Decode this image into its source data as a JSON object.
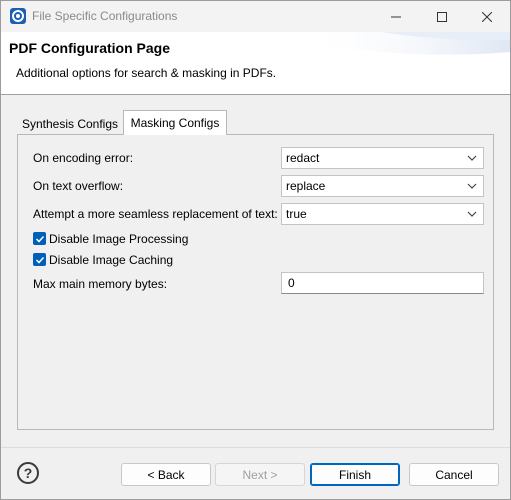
{
  "window": {
    "title": "File Specific Configurations",
    "controls": [
      "minimize-icon",
      "maximize-icon",
      "close-icon"
    ]
  },
  "header": {
    "title": "PDF Configuration Page",
    "subtitle": "Additional options for search & masking in PDFs."
  },
  "tabs": [
    {
      "label": "Synthesis Configs",
      "active": false
    },
    {
      "label": "Masking Configs",
      "active": true
    }
  ],
  "form": {
    "encoding_error": {
      "label": "On encoding error:",
      "value": "redact"
    },
    "text_overflow": {
      "label": "On text overflow:",
      "value": "replace"
    },
    "seamless_replacement": {
      "label": "Attempt a more seamless replacement of text:",
      "value": "true"
    },
    "disable_image_processing": {
      "label": "Disable Image Processing",
      "checked": true
    },
    "disable_image_caching": {
      "label": "Disable Image Caching",
      "checked": true
    },
    "max_memory": {
      "label": "Max main memory bytes:",
      "value": "0"
    }
  },
  "footer": {
    "help_label": "?",
    "back_label": "< Back",
    "next_label": "Next >",
    "finish_label": "Finish",
    "cancel_label": "Cancel"
  },
  "colors": {
    "accent": "#005fb8",
    "default_button_border": "#0067c0",
    "disabled_text": "#a0a0a0"
  }
}
